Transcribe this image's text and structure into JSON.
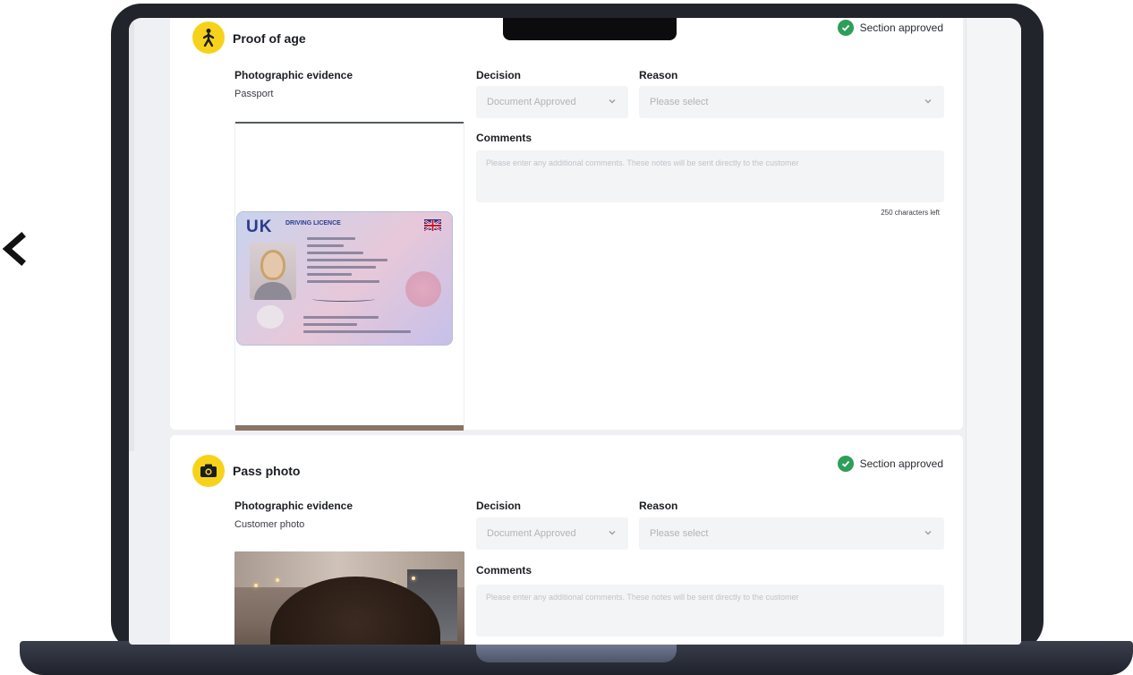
{
  "sections": {
    "age": {
      "title": "Proof of age",
      "status": "Section approved",
      "evidence_label": "Photographic evidence",
      "evidence_type": "Passport",
      "decision_label": "Decision",
      "decision_value": "Document Approved",
      "reason_label": "Reason",
      "reason_placeholder": "Please select",
      "comments_label": "Comments",
      "comments_placeholder": "Please enter any additional comments. These notes will be sent directly to the customer",
      "char_count": "250 characters left",
      "licence": {
        "country": "UK",
        "title": "DRIVING LICENCE"
      }
    },
    "photo": {
      "title": "Pass photo",
      "status": "Section approved",
      "evidence_label": "Photographic evidence",
      "evidence_type": "Customer photo",
      "decision_label": "Decision",
      "decision_value": "Document Approved",
      "reason_label": "Reason",
      "reason_placeholder": "Please select",
      "comments_label": "Comments",
      "comments_placeholder": "Please enter any additional comments. These notes will be sent directly to the customer"
    }
  },
  "colors": {
    "accent": "#f7d21b",
    "approved": "#2e9e5a"
  },
  "icons": {
    "back": "chevron-left-icon",
    "age": "walking-person-icon",
    "photo": "camera-icon",
    "status": "check-circle-icon",
    "select": "chevron-down-icon"
  }
}
